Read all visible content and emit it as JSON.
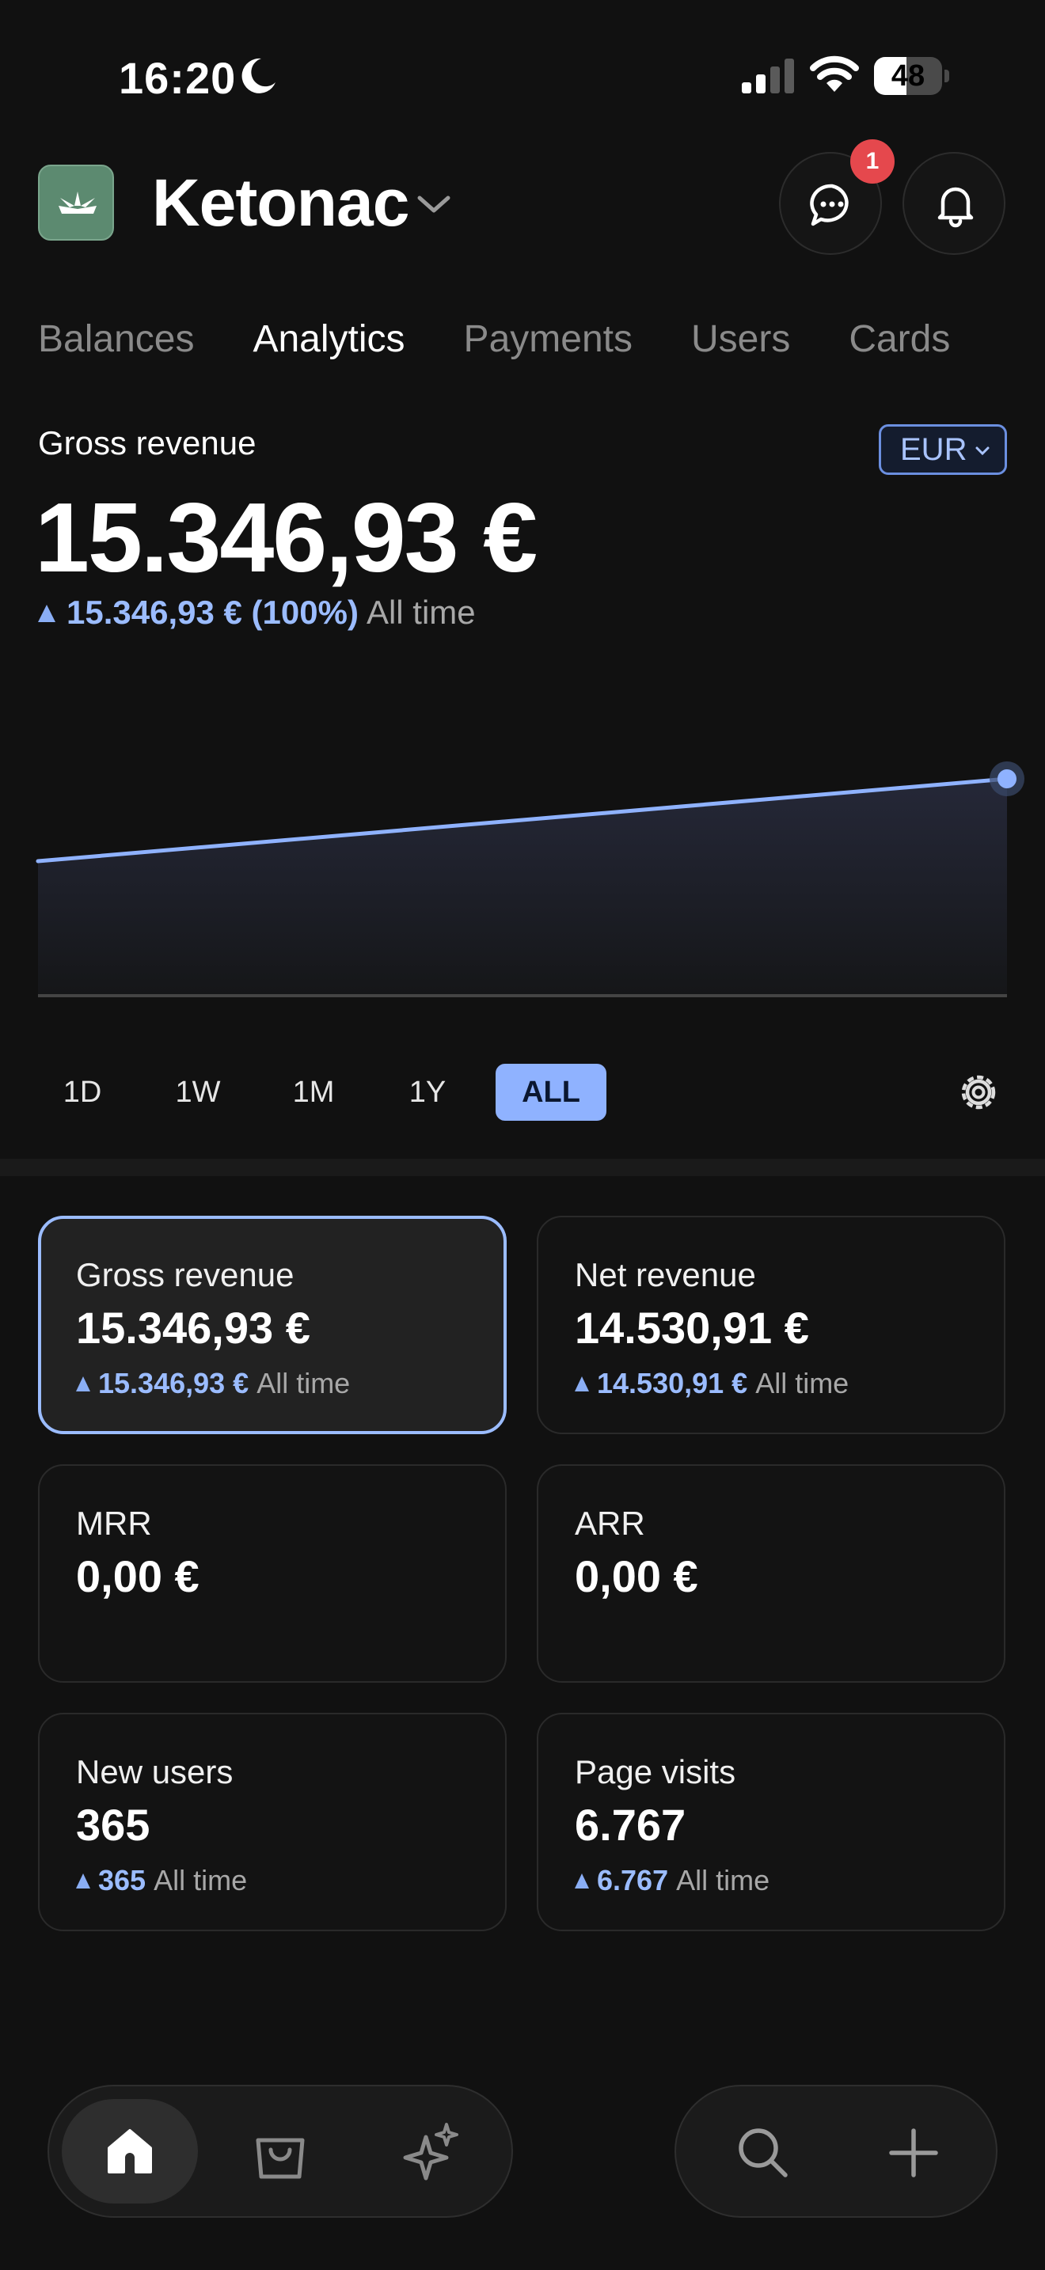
{
  "status_bar": {
    "time": "16:20",
    "battery_percent": "48",
    "battery_level": 0.48
  },
  "header": {
    "app_name": "Ketonac",
    "messages_badge": "1"
  },
  "tabs": [
    {
      "label": "Balances",
      "active": false
    },
    {
      "label": "Analytics",
      "active": true
    },
    {
      "label": "Payments",
      "active": false
    },
    {
      "label": "Users",
      "active": false
    },
    {
      "label": "Cards",
      "active": false
    }
  ],
  "revenue": {
    "label": "Gross revenue",
    "amount": "15.346,93 €",
    "delta_value": "15.346,93 € (100%)",
    "delta_period": "All time",
    "currency": "EUR"
  },
  "chart": {
    "type": "area",
    "start_value": 0.0,
    "end_value": 15346.93,
    "line_color": "#8fb2ff"
  },
  "range_options": [
    {
      "label": "1D",
      "active": false
    },
    {
      "label": "1W",
      "active": false
    },
    {
      "label": "1M",
      "active": false
    },
    {
      "label": "1Y",
      "active": false
    },
    {
      "label": "ALL",
      "active": true
    }
  ],
  "metrics": [
    {
      "title": "Gross revenue",
      "value": "15.346,93 €",
      "delta": "15.346,93 €",
      "period": "All time",
      "selected": true
    },
    {
      "title": "Net revenue",
      "value": "14.530,91 €",
      "delta": "14.530,91 €",
      "period": "All time",
      "selected": false
    },
    {
      "title": "MRR",
      "value": "0,00 €",
      "delta": "",
      "period": "",
      "selected": false
    },
    {
      "title": "ARR",
      "value": "0,00 €",
      "delta": "",
      "period": "",
      "selected": false
    },
    {
      "title": "New users",
      "value": "365",
      "delta": "365",
      "period": "All time",
      "selected": false
    },
    {
      "title": "Page visits",
      "value": "6.767",
      "delta": "6.767",
      "period": "All time",
      "selected": false
    }
  ],
  "colors": {
    "accent": "#8fb2ff",
    "background": "#111111",
    "badge": "#e5484d"
  }
}
